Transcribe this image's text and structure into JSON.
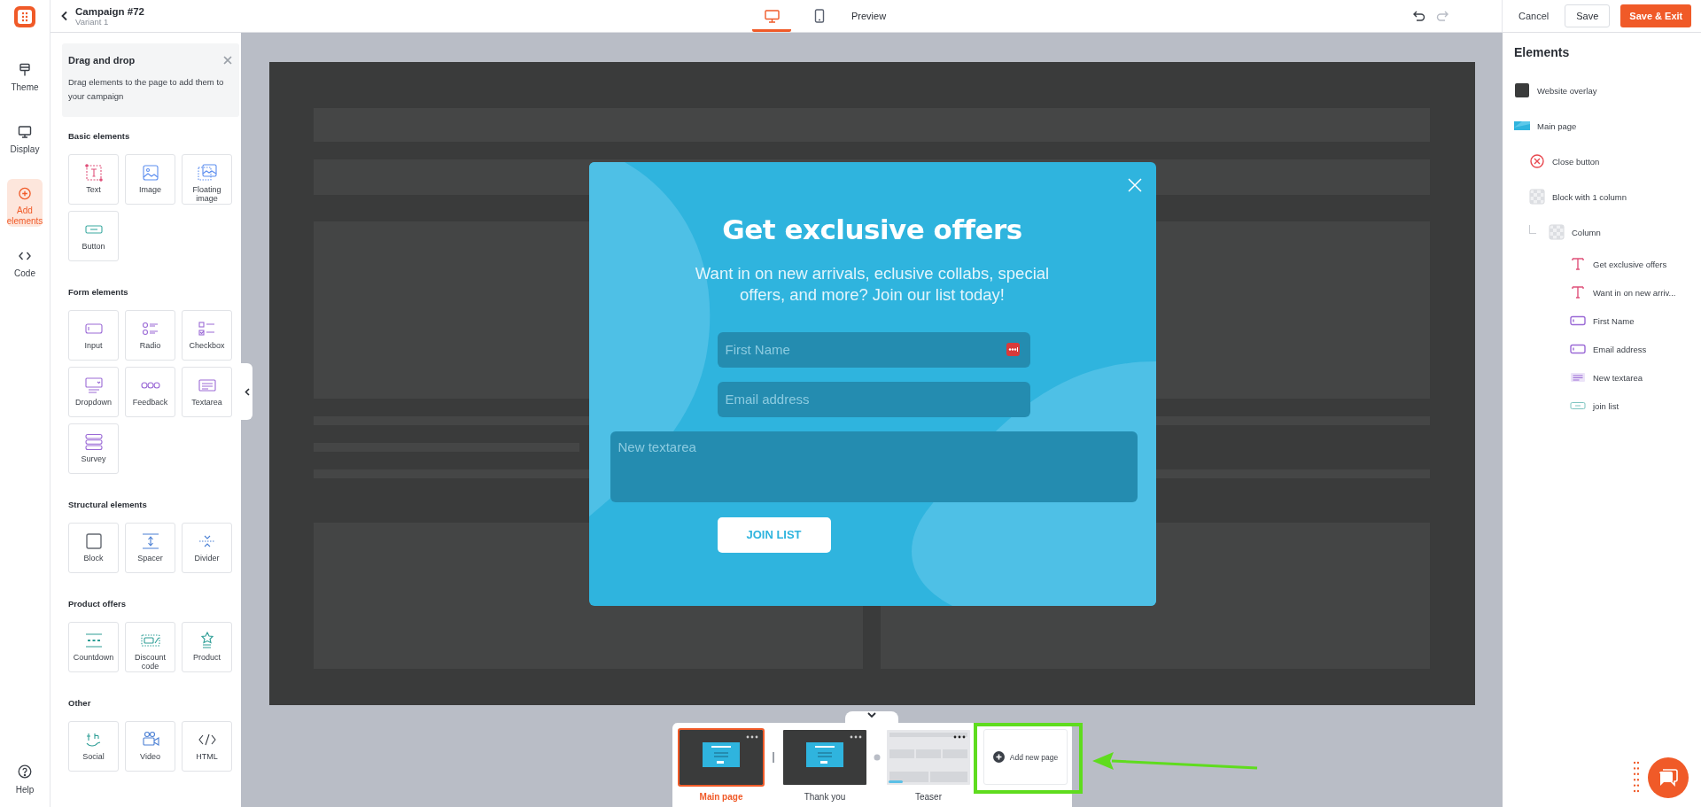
{
  "header": {
    "title": "Campaign #72",
    "subtitle": "Variant 1"
  },
  "rail": {
    "items": [
      {
        "label": "Theme",
        "kind": "theme",
        "selected": false
      },
      {
        "label": "Display",
        "kind": "display",
        "selected": false
      },
      {
        "label": "Add elements",
        "kind": "add",
        "selected": true
      },
      {
        "label": "Code",
        "kind": "code",
        "selected": false
      }
    ],
    "help": "Help"
  },
  "devices": [
    {
      "kind": "desktop",
      "selected": true
    },
    {
      "kind": "mobile",
      "selected": false
    }
  ],
  "preview": "Preview",
  "actions": {
    "cancel": "Cancel",
    "save": "Save",
    "save_exit": "Save & Exit"
  },
  "drag_panel": {
    "title": "Drag and drop",
    "hint": "Drag elements to the page to add them to your campaign",
    "sections": [
      {
        "title": "Basic elements",
        "items": [
          {
            "label": "Text",
            "kind": "text"
          },
          {
            "label": "Image",
            "kind": "image"
          },
          {
            "label": "Floating image",
            "kind": "floating"
          },
          {
            "label": "Button",
            "kind": "button"
          }
        ]
      },
      {
        "title": "Form elements",
        "items": [
          {
            "label": "Input",
            "kind": "input"
          },
          {
            "label": "Radio",
            "kind": "radio"
          },
          {
            "label": "Checkbox",
            "kind": "checkbox"
          },
          {
            "label": "Dropdown",
            "kind": "dropdown"
          },
          {
            "label": "Feedback",
            "kind": "feedback"
          },
          {
            "label": "Textarea",
            "kind": "textarea"
          },
          {
            "label": "Survey",
            "kind": "survey"
          }
        ]
      },
      {
        "title": "Structural elements",
        "items": [
          {
            "label": "Block",
            "kind": "block"
          },
          {
            "label": "Spacer",
            "kind": "spacer"
          },
          {
            "label": "Divider",
            "kind": "divider"
          }
        ]
      },
      {
        "title": "Product offers",
        "items": [
          {
            "label": "Countdown",
            "kind": "countdown"
          },
          {
            "label": "Discount code",
            "kind": "discount"
          },
          {
            "label": "Product",
            "kind": "product"
          }
        ]
      },
      {
        "title": "Other",
        "items": [
          {
            "label": "Social",
            "kind": "social"
          },
          {
            "label": "Video",
            "kind": "video"
          },
          {
            "label": "HTML",
            "kind": "html"
          }
        ]
      }
    ]
  },
  "popup": {
    "title": "Get exclusive offers",
    "text": "Want in on new arrivals, eclusive collabs, special offers, and more? Join our list today!",
    "fields": [
      {
        "placeholder": "First Name",
        "kind": "input",
        "password_manager": true
      },
      {
        "placeholder": "Email address",
        "kind": "input",
        "password_manager": false
      },
      {
        "placeholder": "New textarea",
        "kind": "textarea",
        "password_manager": false
      }
    ],
    "button": "JOIN LIST"
  },
  "pages": [
    {
      "label": "Main page",
      "kind": "popup",
      "selected": true
    },
    {
      "label": "Thank you",
      "kind": "popup",
      "selected": false
    },
    {
      "label": "Teaser",
      "kind": "teaser",
      "selected": false
    }
  ],
  "add_page": "Add new page",
  "elements_panel": {
    "title": "Elements",
    "tree": [
      {
        "label": "Website overlay",
        "kind": "overlay"
      },
      {
        "label": "Main page",
        "kind": "page",
        "children": [
          {
            "label": "Close button",
            "kind": "close"
          },
          {
            "label": "Block with 1 column",
            "kind": "block",
            "children": [
              {
                "label": "Column",
                "kind": "column",
                "children": [
                  {
                    "label": "Get exclusive offers",
                    "kind": "text"
                  },
                  {
                    "label": "Want in on new arriv...",
                    "kind": "text"
                  },
                  {
                    "label": "First Name",
                    "kind": "input"
                  },
                  {
                    "label": "Email address",
                    "kind": "input"
                  },
                  {
                    "label": "New textarea",
                    "kind": "textarea"
                  },
                  {
                    "label": "join list",
                    "kind": "button"
                  }
                ]
              }
            ]
          }
        ]
      }
    ]
  }
}
